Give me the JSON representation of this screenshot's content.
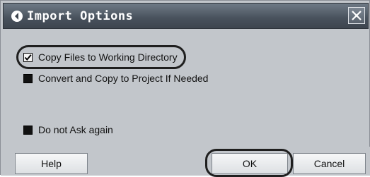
{
  "window": {
    "title": "Import Options",
    "title_icon": "arrow-circle-icon",
    "close_icon": "close-icon"
  },
  "options": [
    {
      "label": "Copy Files to Working Directory",
      "checked": true
    },
    {
      "label": "Convert and Copy to Project If Needed",
      "checked": false
    },
    {
      "label": "Do not Ask again",
      "checked": false
    }
  ],
  "buttons": {
    "help": "Help",
    "ok": "OK",
    "cancel": "Cancel"
  }
}
